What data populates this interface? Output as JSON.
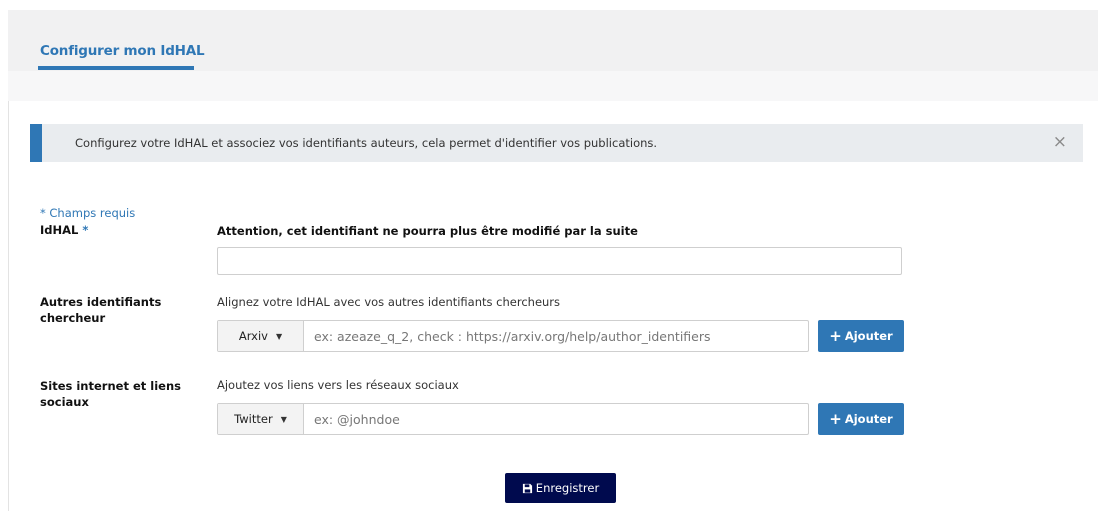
{
  "tabs": {
    "active_label": "Configurer mon IdHAL"
  },
  "alert": {
    "message": "Configurez votre IdHAL et associez vos identifiants auteurs, cela permet d'identifier vos publications.",
    "close_glyph": "×"
  },
  "form": {
    "required_note": "* Champs requis",
    "idhal": {
      "label": "IdHAL",
      "required_mark": "*",
      "warning": "Attention, cet identifiant ne pourra plus être modifié par la suite",
      "value": ""
    },
    "other_ids": {
      "label_line1": "Autres identifiants",
      "label_line2": "chercheur",
      "hint": "Alignez votre IdHAL avec vos autres identifiants chercheurs",
      "selected_type": "Arxiv",
      "placeholder": "ex: azeaze_q_2, check : https://arxiv.org/help/author_identifiers",
      "add_label": "Ajouter"
    },
    "social": {
      "label_line1": "Sites internet et liens",
      "label_line2": "sociaux",
      "hint": "Ajoutez vos liens vers les réseaux sociaux",
      "selected_type": "Twitter",
      "placeholder": "ex: @johndoe",
      "add_label": "Ajouter"
    },
    "save_label": "Enregistrer"
  },
  "icons": {
    "caret": "chevron-down-icon",
    "plus": "plus-icon",
    "save": "floppy-disk-icon",
    "close": "close-icon"
  },
  "colors": {
    "accent": "#2f77b5",
    "save_button": "#000a4e",
    "alert_bg": "#e9ecef"
  }
}
